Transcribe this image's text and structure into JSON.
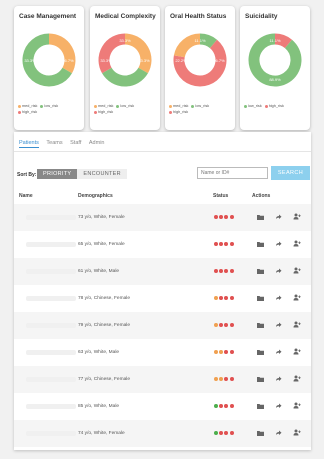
{
  "cards": [
    {
      "title": "Case Management",
      "ring": [
        {
          "value": 33.3,
          "color": "#f7b168"
        },
        {
          "value": 66.7,
          "color": "#82c27d"
        }
      ],
      "labels": [
        {
          "text": "33.3%",
          "pos": "left"
        },
        {
          "text": "66.7%",
          "pos": "right"
        }
      ],
      "legend": [
        {
          "label": "med_risk",
          "color": "#f7b168"
        },
        {
          "label": "low_risk",
          "color": "#82c27d"
        },
        {
          "label": "high_risk",
          "color": "#ee7b79"
        }
      ]
    },
    {
      "title": "Medical Complexity",
      "ring": [
        {
          "value": 33.3,
          "color": "#f7b168"
        },
        {
          "value": 33.3,
          "color": "#82c27d"
        },
        {
          "value": 33.3,
          "color": "#ee7b79"
        }
      ],
      "labels": [
        {
          "text": "33.3%",
          "pos": "top"
        },
        {
          "text": "33.3%",
          "pos": "left"
        },
        {
          "text": "33.3%",
          "pos": "right"
        }
      ],
      "legend": [
        {
          "label": "med_risk",
          "color": "#f7b168"
        },
        {
          "label": "low_risk",
          "color": "#82c27d"
        },
        {
          "label": "high_risk",
          "color": "#ee7b79"
        }
      ]
    },
    {
      "title": "Oral Health Status",
      "ring": [
        {
          "value": 11.1,
          "color": "#82c27d"
        },
        {
          "value": 66.7,
          "color": "#ee7b79"
        },
        {
          "value": 22.2,
          "color": "#f7b168"
        }
      ],
      "labels": [
        {
          "text": "11.1%",
          "pos": "top"
        },
        {
          "text": "22.2%",
          "pos": "left"
        },
        {
          "text": "66.7%",
          "pos": "right"
        }
      ],
      "legend": [
        {
          "label": "med_risk",
          "color": "#f7b168"
        },
        {
          "label": "low_risk",
          "color": "#82c27d"
        },
        {
          "label": "high_risk",
          "color": "#ee7b79"
        }
      ]
    },
    {
      "title": "Suicidality",
      "ring": [
        {
          "value": 11.1,
          "color": "#ee7b79"
        },
        {
          "value": 88.9,
          "color": "#82c27d"
        }
      ],
      "labels": [
        {
          "text": "11.1%",
          "pos": "top"
        },
        {
          "text": "88.9%",
          "pos": "bottom"
        }
      ],
      "legend": [
        {
          "label": "low_risk",
          "color": "#82c27d"
        },
        {
          "label": "high_risk",
          "color": "#ee7b79"
        }
      ]
    }
  ],
  "tabs": [
    "Patients",
    "Teams",
    "Staff",
    "Admin"
  ],
  "sort": {
    "label": "Sort By:",
    "options": [
      "PRIORITY",
      "ENCOUNTER"
    ]
  },
  "search": {
    "placeholder": "Name or ID#",
    "button": "SEARCH"
  },
  "table": {
    "headers": {
      "name": "Name",
      "demographics": "Demographics",
      "status": "Status",
      "actions": "Actions"
    },
    "rows": [
      {
        "demographics": "73 y/o, White, Female",
        "status": [
          "#e05050",
          "#e05050",
          "#e05050",
          "#e05050"
        ]
      },
      {
        "demographics": "65 y/o, White, Female",
        "status": [
          "#e05050",
          "#e05050",
          "#e05050",
          "#e05050"
        ]
      },
      {
        "demographics": "61 y/o, White, Male",
        "status": [
          "#e05050",
          "#e05050",
          "#e05050",
          "#e05050"
        ]
      },
      {
        "demographics": "78 y/o, Chinese, Female",
        "status": [
          "#f0a050",
          "#e05050",
          "#e05050",
          "#e05050"
        ]
      },
      {
        "demographics": "79 y/o, Chinese, Female",
        "status": [
          "#f0a050",
          "#e05050",
          "#e05050",
          "#e05050"
        ]
      },
      {
        "demographics": "63 y/o, White, Male",
        "status": [
          "#f0a050",
          "#f0a050",
          "#e05050",
          "#e05050"
        ]
      },
      {
        "demographics": "77 y/o, Chinese, Female",
        "status": [
          "#f0a050",
          "#f0a050",
          "#e05050",
          "#e05050"
        ]
      },
      {
        "demographics": "85 y/o, White, Male",
        "status": [
          "#4cae4c",
          "#e05050",
          "#e05050",
          "#e05050"
        ]
      },
      {
        "demographics": "74 y/o, White, Female",
        "status": [
          "#4cae4c",
          "#e05050",
          "#e05050",
          "#e05050"
        ]
      }
    ]
  }
}
